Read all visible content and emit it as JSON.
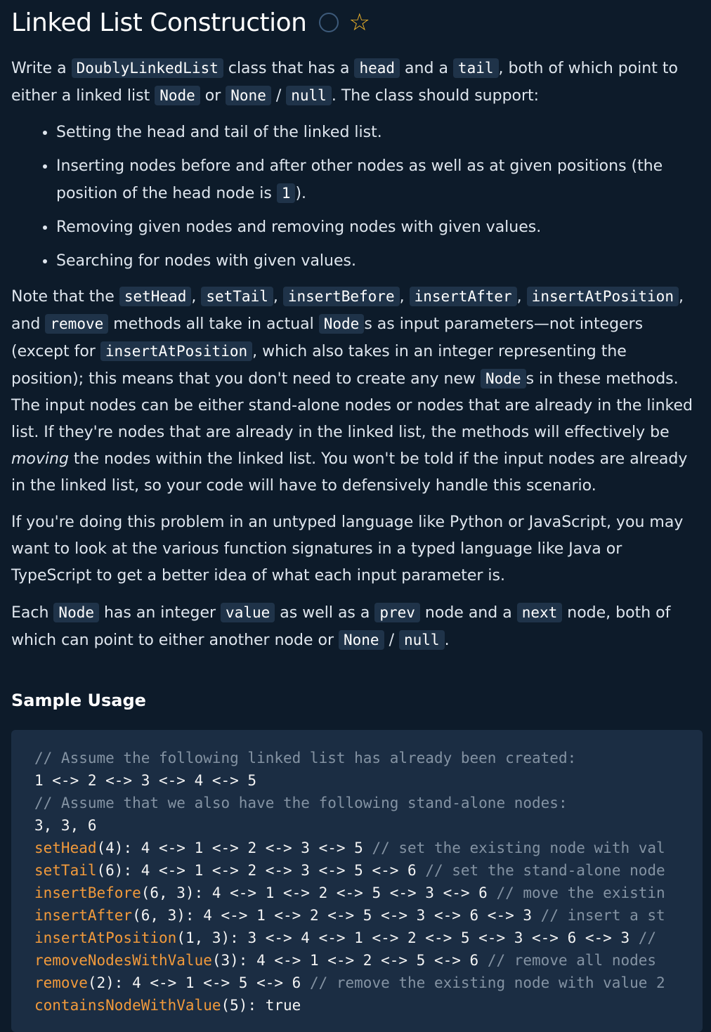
{
  "title": "Linked List Construction",
  "intro": {
    "t1": "Write a ",
    "c1": "DoublyLinkedList",
    "t2": " class that has a ",
    "c2": "head",
    "t3": " and a ",
    "c3": "tail",
    "t4": ", both of which point to either a linked list ",
    "c4": "Node",
    "t5": " or ",
    "c5": "None",
    "t6": " / ",
    "c6": "null",
    "t7": ". The class should support:"
  },
  "bullets": {
    "b1": "Setting the head and tail of the linked list.",
    "b2a": "Inserting nodes before and after other nodes as well as at given positions (the position of the head node is ",
    "b2c": "1",
    "b2b": ").",
    "b3": "Removing given nodes and removing nodes with given values.",
    "b4": "Searching for nodes with given values."
  },
  "note": {
    "t1": "Note that the ",
    "c1": "setHead",
    "t2": ", ",
    "c2": "setTail",
    "t3": ", ",
    "c3": "insertBefore",
    "t4": ", ",
    "c4": "insertAfter",
    "t5": ", ",
    "c5": "insertAtPosition",
    "t6": ", and ",
    "c6": "remove",
    "t7": " methods all take in actual ",
    "c7": "Node",
    "t8": "s as input parameters—not integers (except for ",
    "c8": "insertAtPosition",
    "t9": ", which also takes in an integer representing the position); this means that you don't need to create any new ",
    "c9": "Node",
    "t10": "s in these methods. The input nodes can be either stand-alone nodes or nodes that are already in the linked list. If they're nodes that are already in the linked list, the methods will effectively be ",
    "em": "moving",
    "t11": " the nodes within the linked list. You won't be told if the input nodes are already in the linked list, so your code will have to defensively handle this scenario."
  },
  "untyped": "If you're doing this problem in an untyped language like Python or JavaScript, you may want to look at the various function signatures in a typed language like Java or TypeScript to get a better idea of what each input parameter is.",
  "node_desc": {
    "t1": "Each ",
    "c1": "Node",
    "t2": " has an integer ",
    "c2": "value",
    "t3": " as well as a ",
    "c3": "prev",
    "t4": " node and a ",
    "c4": "next",
    "t5": " node, both of which can point to either another node or ",
    "c5": "None",
    "t6": " / ",
    "c6": "null",
    "t7": "."
  },
  "sample_title": "Sample Usage",
  "sample": {
    "l1": "// Assume the following linked list has already been created:",
    "l2": "1 <-> 2 <-> 3 <-> 4 <-> 5",
    "l3": "// Assume that we also have the following stand-alone nodes:",
    "l4": "3, 3, 6",
    "l5_fn": "setHead",
    "l5_args": "(4): 4 <-> 1 <-> 2 <-> 3 <-> 5 ",
    "l5_cm": "// set the existing node with val",
    "l6_fn": "setTail",
    "l6_args": "(6): 4 <-> 1 <-> 2 <-> 3 <-> 5 <-> 6 ",
    "l6_cm": "// set the stand-alone node",
    "l7_fn": "insertBefore",
    "l7_args": "(6, 3): 4 <-> 1 <-> 2 <-> 5 <-> 3 <-> 6 ",
    "l7_cm": "// move the existin",
    "l8_fn": "insertAfter",
    "l8_args": "(6, 3): 4 <-> 1 <-> 2 <-> 5 <-> 3 <-> 6 <-> 3 ",
    "l8_cm": "// insert a st",
    "l9_fn": "insertAtPosition",
    "l9_args": "(1, 3): 3 <-> 4 <-> 1 <-> 2 <-> 5 <-> 3 <-> 6 <-> 3 ",
    "l9_cm": "//",
    "l10_fn": "removeNodesWithValue",
    "l10_args": "(3): 4 <-> 1 <-> 2 <-> 5 <-> 6 ",
    "l10_cm": "// remove all nodes",
    "l11_fn": "remove",
    "l11_args": "(2): 4 <-> 1 <-> 5 <-> 6 ",
    "l11_cm": "// remove the existing node with value 2",
    "l12_fn": "containsNodeWithValue",
    "l12_args": "(5): true"
  }
}
